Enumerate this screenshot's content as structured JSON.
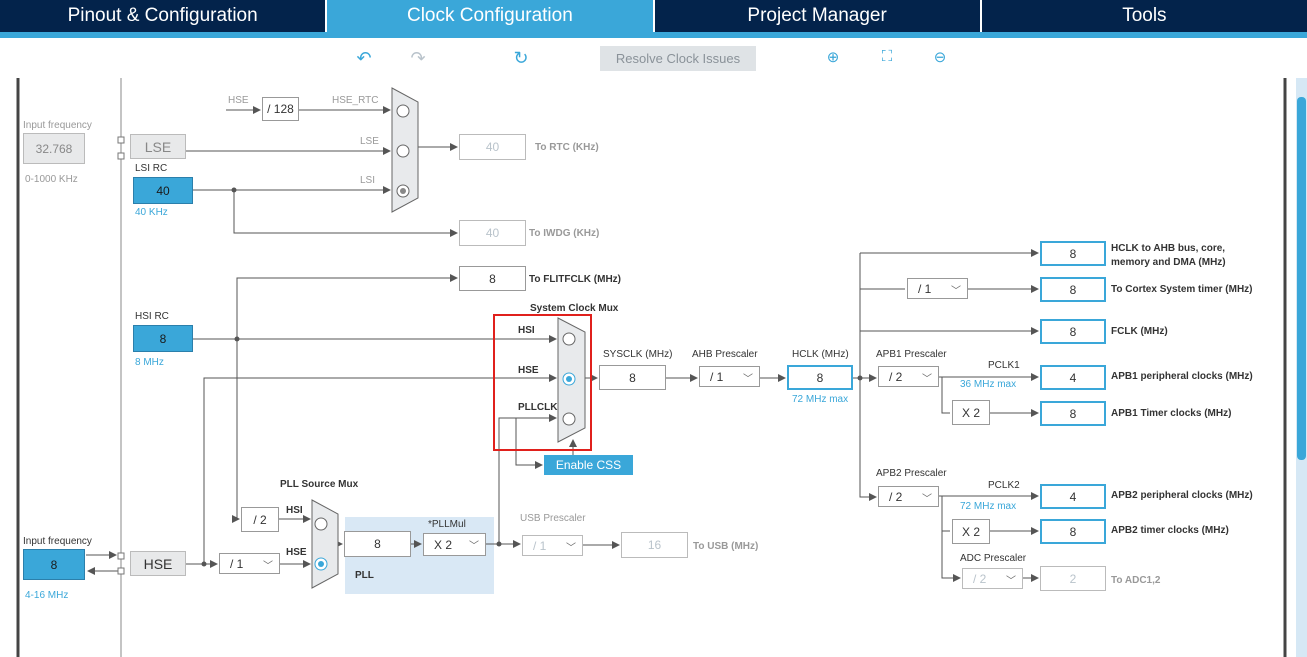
{
  "tabs": [
    "Pinout & Configuration",
    "Clock Configuration",
    "Project Manager",
    "Tools"
  ],
  "active_tab": 1,
  "toolbar": {
    "undo": "undo-icon",
    "redo": "redo-icon",
    "refresh": "refresh-icon",
    "resolve": "Resolve Clock Issues",
    "zoom_in": "zoom-in-icon",
    "fit": "fit-icon",
    "zoom_out": "zoom-out-icon"
  },
  "lse": {
    "input_label": "Input frequency",
    "input_value": "32.768",
    "range": "0-1000 KHz",
    "name": "LSE"
  },
  "lsi": {
    "label": "LSI RC",
    "value": "40",
    "freq": "40 KHz"
  },
  "rtc": {
    "hse_label": "HSE",
    "div": "/ 128",
    "hse_rtc": "HSE_RTC",
    "lse": "LSE",
    "lsi": "LSI",
    "out": "40",
    "out_label": "To RTC (KHz)"
  },
  "iwdg": {
    "out": "40",
    "label": "To IWDG (KHz)"
  },
  "flit": {
    "out": "8",
    "label": "To FLITFCLK (MHz)"
  },
  "hsi": {
    "label": "HSI RC",
    "value": "8",
    "freq": "8 MHz"
  },
  "sysmux": {
    "title": "System Clock Mux",
    "hsi": "HSI",
    "hse": "HSE",
    "pll": "PLLCLK",
    "selected": "HSE"
  },
  "css": "Enable CSS",
  "sysclk": {
    "label": "SYSCLK (MHz)",
    "value": "8"
  },
  "ahb": {
    "label": "AHB Prescaler",
    "value": "/ 1"
  },
  "hclk": {
    "label": "HCLK (MHz)",
    "value": "8",
    "max": "72 MHz max"
  },
  "cortex_div": "/ 1",
  "apb1": {
    "label": "APB1 Prescaler",
    "value": "/ 2",
    "pclk": "PCLK1",
    "max": "36 MHz max",
    "mul": "X 2"
  },
  "apb2": {
    "label": "APB2 Prescaler",
    "value": "/ 2",
    "pclk": "PCLK2",
    "max": "72 MHz max",
    "mul": "X 2"
  },
  "adc": {
    "label": "ADC Prescaler",
    "value": "/ 2",
    "out": "2",
    "out_label": "To ADC1,2"
  },
  "outputs": [
    {
      "value": "8",
      "label": "HCLK to AHB bus, core,",
      "label2": "memory and DMA (MHz)"
    },
    {
      "value": "8",
      "label": "To Cortex System timer (MHz)"
    },
    {
      "value": "8",
      "label": "FCLK (MHz)"
    },
    {
      "value": "4",
      "label": "APB1 peripheral clocks (MHz)"
    },
    {
      "value": "8",
      "label": "APB1 Timer clocks (MHz)"
    },
    {
      "value": "4",
      "label": "APB2 peripheral clocks (MHz)"
    },
    {
      "value": "8",
      "label": "APB2 timer clocks (MHz)"
    }
  ],
  "pllsrc": {
    "title": "PLL Source Mux",
    "hsi": "HSI",
    "hse": "HSE",
    "hsi_div": "/ 2",
    "selected": "HSE"
  },
  "pll": {
    "mul_label": "*PLLMul",
    "input": "8",
    "mul": "X 2",
    "name": "PLL"
  },
  "usb": {
    "label": "USB Prescaler",
    "value": "/ 1",
    "out": "16",
    "out_label": "To USB (MHz)"
  },
  "hse": {
    "input_label": "Input frequency",
    "input_value": "8",
    "range": "4-16 MHz",
    "name": "HSE",
    "div": "/ 1"
  },
  "colors": {
    "accent": "#3aa7d9",
    "navy": "#03234b",
    "highlight": "#e0201c"
  }
}
